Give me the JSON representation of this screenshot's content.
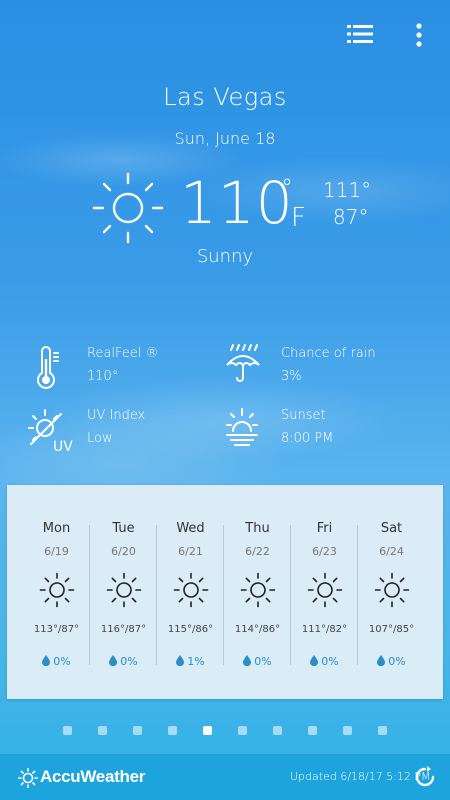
{
  "header": {
    "city": "Las Vegas",
    "date": "Sun, June 18",
    "temperature": "110",
    "degree_symbol": "°",
    "unit": "F",
    "high": "111°",
    "low": "87°",
    "condition": "Sunny"
  },
  "details": {
    "realfeel": {
      "label": "RealFeel ®",
      "value": "110°"
    },
    "rain": {
      "label": "Chance of rain",
      "value": "3%"
    },
    "uv": {
      "label": "UV Index",
      "value": "Low"
    },
    "sunset": {
      "label": "Sunset",
      "value": "8:00 PM"
    }
  },
  "forecast": [
    {
      "day": "Mon",
      "date": "6/19",
      "temps": "113°/87°",
      "rain": "0%"
    },
    {
      "day": "Tue",
      "date": "6/20",
      "temps": "116°/87°",
      "rain": "0%"
    },
    {
      "day": "Wed",
      "date": "6/21",
      "temps": "115°/86°",
      "rain": "1%"
    },
    {
      "day": "Thu",
      "date": "6/22",
      "temps": "114°/86°",
      "rain": "0%"
    },
    {
      "day": "Fri",
      "date": "6/23",
      "temps": "111°/82°",
      "rain": "0%"
    },
    {
      "day": "Sat",
      "date": "6/24",
      "temps": "107°/85°",
      "rain": "0%"
    }
  ],
  "pager": {
    "count": 10,
    "active_index": 4
  },
  "footer": {
    "brand": "AccuWeather",
    "updated": "Updated 6/18/17 5:12 PM"
  },
  "icons": {
    "menu": "list-icon",
    "more": "more-vertical-icon",
    "refresh": "refresh-icon"
  },
  "colors": {
    "footer": "#1da4dd",
    "rain_text": "#2a8fc8"
  }
}
